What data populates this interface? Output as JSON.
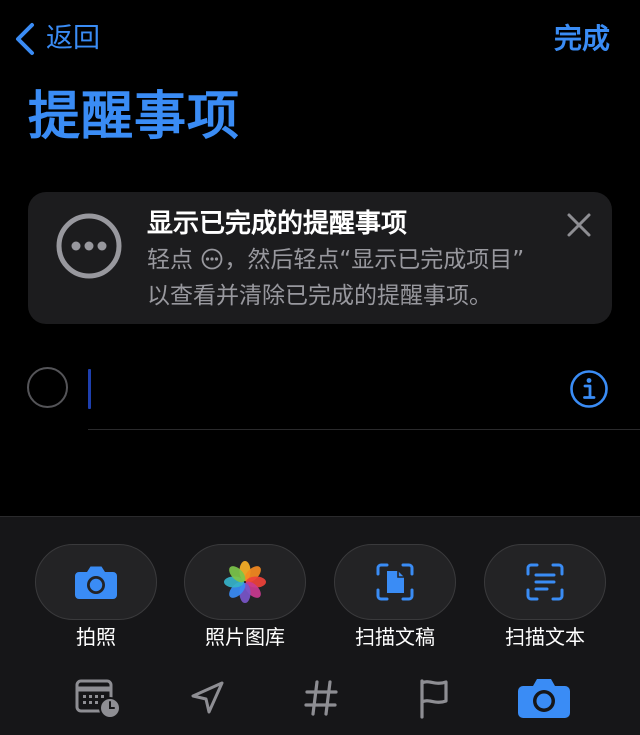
{
  "nav": {
    "back_label": "返回",
    "done_label": "完成"
  },
  "page": {
    "title": "提醒事项"
  },
  "tip": {
    "title": "显示已完成的提醒事项",
    "line1_prefix": "轻点",
    "line1_suffix": "，然后轻点“显示已完成项目”",
    "line2": "以查看并清除已完成的提醒事项。"
  },
  "new_item": {
    "value": ""
  },
  "quick_actions": [
    {
      "label": "拍照",
      "icon": "camera-icon"
    },
    {
      "label": "照片图库",
      "icon": "photos-icon"
    },
    {
      "label": "扫描文稿",
      "icon": "scan-document-icon"
    },
    {
      "label": "扫描文本",
      "icon": "scan-text-icon"
    }
  ],
  "toolbar": [
    "calendar-clock-icon",
    "location-icon",
    "tag-icon",
    "flag-icon",
    "camera-icon"
  ],
  "colors": {
    "accent": "#3a8cf5",
    "background": "#000000",
    "card": "#1c1c1e",
    "secondary_text": "#98989e"
  }
}
